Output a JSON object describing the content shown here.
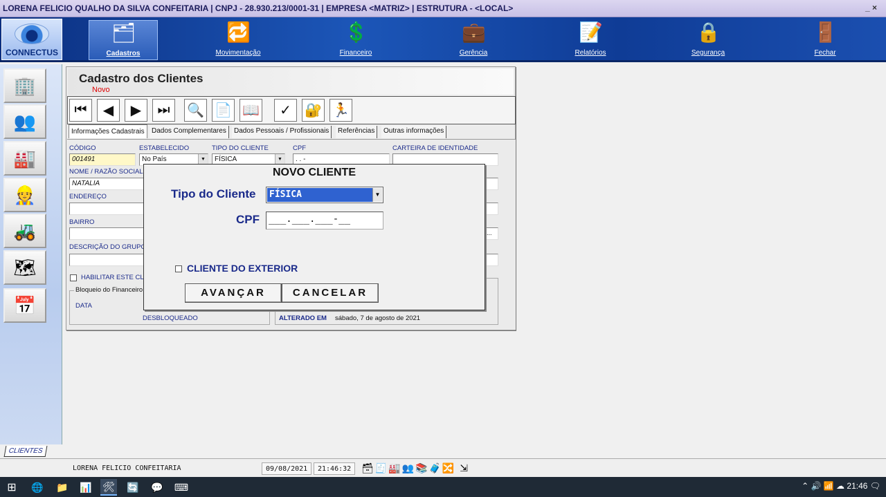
{
  "window": {
    "title": "LORENA FELICIO QUALHO DA SILVA CONFEITARIA | CNPJ - 28.930.213/0001-31 | EMPRESA <MATRIZ> | ESTRUTURA - <LOCAL>",
    "controls": "_ ×"
  },
  "logo": {
    "name": "CONNECTUS"
  },
  "modules": [
    {
      "label": "Cadastros",
      "icon": "🗂"
    },
    {
      "label": "Movimentação",
      "icon": "🔁"
    },
    {
      "label": "Financeiro",
      "icon": "💲"
    },
    {
      "label": "Gerência",
      "icon": "💼"
    },
    {
      "label": "Relatórios",
      "icon": "📝"
    },
    {
      "label": "Segurança",
      "icon": "🔒"
    },
    {
      "label": "Fechar",
      "icon": "🚪"
    }
  ],
  "sidebar": [
    "🏢",
    "👥",
    "🏭",
    "👷",
    "🚜",
    "🗺",
    "📅"
  ],
  "form": {
    "title": "Cadastro dos Clientes",
    "mode": "Novo",
    "tabs": [
      "Informações Cadastrais",
      "Dados Complementares",
      "Dados Pessoais / Profissionais",
      "Referências",
      "Outras informações"
    ],
    "labels": {
      "codigo": "CÓDIGO",
      "estabelecido": "ESTABELECIDO",
      "tipo": "TIPO DO CLIENTE",
      "cpf": "CPF",
      "rg": "CARTEIRA DE IDENTIDADE",
      "nome": "NOME / RAZÃO SOCIAL",
      "endereco": "ENDEREÇO",
      "bairro": "BAIRRO",
      "grupo": "DESCRIÇÃO DO GRUPO",
      "habilitar": "HABILITAR ESTE CL",
      "bloqueio": "Bloqueio do Financeiro",
      "data": "DATA",
      "desbloqueado": "DESBLOQUEADO",
      "alterado": "ALTERADO EM"
    },
    "values": {
      "codigo": "001491",
      "estabelecido": "No País",
      "tipo": "FÍSICA",
      "cpf": " .   .   -",
      "nome": "NATALIA",
      "alterado": "sábado, 7 de agosto de 2021",
      "ellipsis": "..."
    }
  },
  "modal": {
    "title": "NOVO CLIENTE",
    "tipo_label": "Tipo do Cliente",
    "tipo_value": "FÍSICA",
    "cpf_label": "CPF",
    "cpf_value": "___.___.___-__",
    "exterior_label": "CLIENTE DO EXTERIOR",
    "btn_next": "AVANÇAR",
    "btn_cancel": "CANCELAR"
  },
  "bottom_tab": "CLIENTES",
  "status": {
    "company": "LORENA FELICIO CONFEITARIA",
    "date": "09/08/2021",
    "time": "21:46:32"
  },
  "taskbar": {
    "clock": "21:46"
  }
}
